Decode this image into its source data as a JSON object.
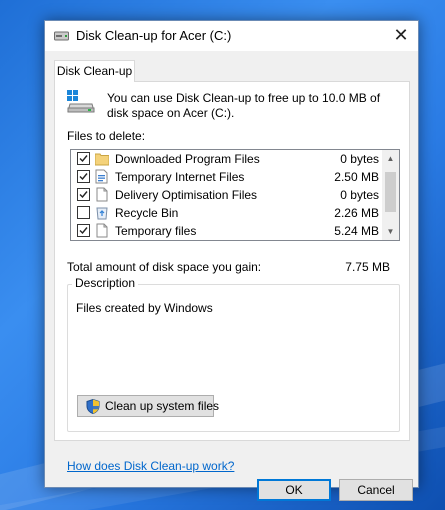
{
  "window": {
    "title": "Disk Clean-up for Acer (C:)",
    "close_symbol": "✕"
  },
  "tab": {
    "label": "Disk Clean-up"
  },
  "intro": {
    "text": "You can use Disk Clean-up to free up to 10.0 MB of disk space on Acer (C:)."
  },
  "files": {
    "label": "Files to delete:",
    "items": [
      {
        "name": "Downloaded Program Files",
        "size": "0 bytes",
        "checked": true,
        "icon": "folder-icon"
      },
      {
        "name": "Temporary Internet Files",
        "size": "2.50 MB",
        "checked": true,
        "icon": "internet-files-icon"
      },
      {
        "name": "Delivery Optimisation Files",
        "size": "0 bytes",
        "checked": true,
        "icon": "file-icon"
      },
      {
        "name": "Recycle Bin",
        "size": "2.26 MB",
        "checked": false,
        "icon": "recycle-bin-icon"
      },
      {
        "name": "Temporary files",
        "size": "5.24 MB",
        "checked": true,
        "icon": "file-icon"
      }
    ]
  },
  "gain": {
    "label": "Total amount of disk space you gain:",
    "value": "7.75 MB"
  },
  "description": {
    "legend": "Description",
    "text": "Files created by Windows"
  },
  "cleanup_button": {
    "label": "Clean up system files"
  },
  "help_link": {
    "label": "How does Disk Clean-up work?"
  },
  "buttons": {
    "ok": "OK",
    "cancel": "Cancel"
  },
  "colors": {
    "accent": "#0078d7",
    "link": "#0066cc",
    "desktop": "#2a7be4"
  }
}
